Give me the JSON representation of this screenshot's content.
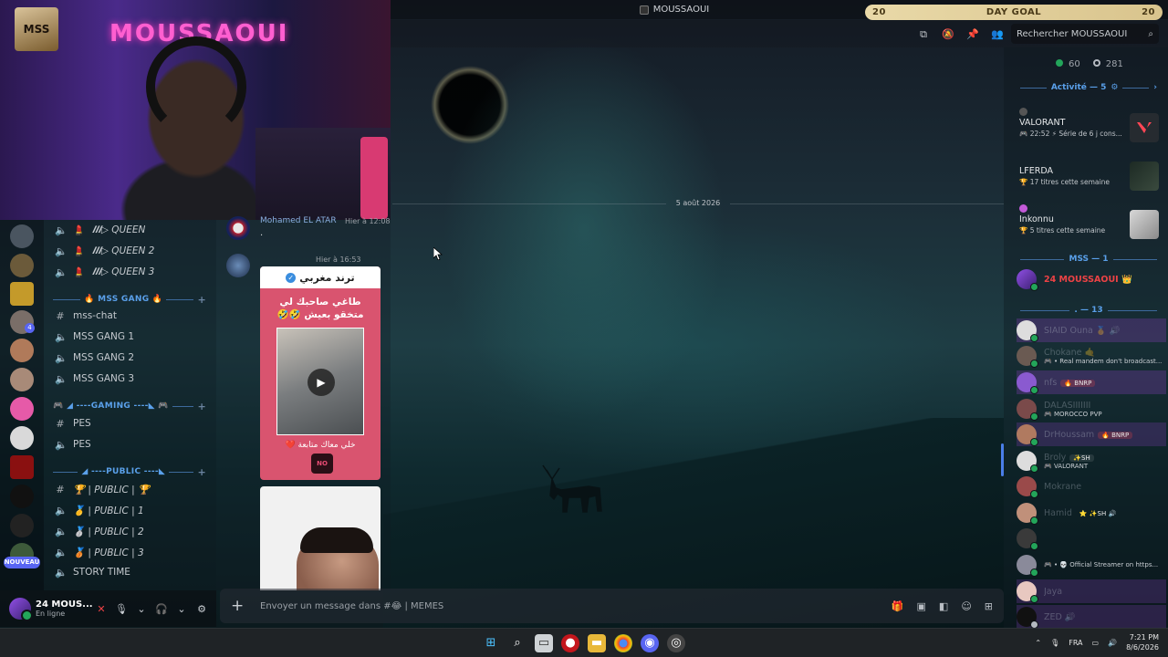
{
  "window": {
    "title": "MOUSSAOUI"
  },
  "day_goal": {
    "label": "DAY GOAL",
    "left_value": "20",
    "right_value": "20",
    "progress": 1.0
  },
  "search": {
    "placeholder": "Rechercher MOUSSAOUI"
  },
  "date_separator": "5 août 2026",
  "cam": {
    "neon_text": "MOUSSAOUI",
    "logo_text": "MSS"
  },
  "rail": {
    "badge": "4",
    "new_label": "NOUVEAU"
  },
  "channels": {
    "items_top": [
      {
        "icon": "speaker",
        "label": "𝑰𝑰𝑰▷ QUEEN",
        "emoji": "💄"
      },
      {
        "icon": "speaker",
        "label": "𝑰𝑰𝑰▷ QUEEN 2",
        "emoji": "💄"
      },
      {
        "icon": "speaker",
        "label": "𝑰𝑰𝑰▷ QUEEN 3",
        "emoji": "💄"
      }
    ],
    "cat_gang": "🔥 MSS GANG 🔥",
    "gang": [
      {
        "icon": "#",
        "label": "mss-chat"
      },
      {
        "icon": "speaker",
        "label": "MSS GANG 1"
      },
      {
        "icon": "speaker",
        "label": "MSS GANG 2"
      },
      {
        "icon": "speaker",
        "label": "MSS GANG 3"
      }
    ],
    "cat_gaming": "🎮 ◢ ----GAMING ----◣ 🎮",
    "gaming": [
      {
        "icon": "#",
        "label": "PES"
      },
      {
        "icon": "speaker",
        "label": "PES"
      }
    ],
    "cat_public": "◢ ----PUBLIC ----◣",
    "public": [
      {
        "icon": "#",
        "label": "🏆 | PUBLIC | 🏆"
      },
      {
        "icon": "speaker",
        "label": "🥇 | PUBLIC | 1"
      },
      {
        "icon": "speaker",
        "label": "🥈 | PUBLIC | 2"
      },
      {
        "icon": "speaker",
        "label": "🥉 | PUBLIC | 3"
      },
      {
        "icon": "speaker",
        "label": "STORY TIME"
      }
    ]
  },
  "chat": {
    "msg1_author": "Mohamed EL ATAR",
    "msg1_time": "Hier à 12:08",
    "msg1_text": ".",
    "msg2_author": "",
    "msg2_time": "Hier à 16:53",
    "card_header": "ترند مغربي",
    "card_caption": "طاغي صاحبك لي متخقو بعيش 🤣🤣",
    "card_footer": "خلي معاك متابعة ❤️",
    "card_logo": "NO FILL"
  },
  "user_panel": {
    "name": "24 MOUS...",
    "status": "En ligne"
  },
  "composer": {
    "placeholder": "Envoyer un message dans #😂 | MEMES"
  },
  "members": {
    "online": "60",
    "total": "281",
    "activity_header": "Activité — 5",
    "activities": [
      {
        "game": "VALORANT",
        "sub": "🎮 22:52 ⚡ Série de 6 j cons..."
      },
      {
        "game": "LFERDA",
        "sub": "🏆 17 titres cette semaine"
      },
      {
        "game": "Inkonnu",
        "sub": "🏆 5 titres cette semaine"
      }
    ],
    "mss_header": "MSS — 1",
    "owner": "24 MOUSSAOUI 👑",
    "group_header": ". — 13",
    "list": [
      {
        "name": "SIAID Ouna 🥇 🔊",
        "sub": ""
      },
      {
        "name": "Chokane 🤙",
        "sub": "🎮 • Real mandem don't broadcast..."
      },
      {
        "name": "nfs",
        "tag": "🔥 BNRP",
        "sub": ""
      },
      {
        "name": "DALASIIIIIII",
        "sub": "🎮 MOROCCO PVP"
      },
      {
        "name": "DrHoussam",
        "tag": "🔥 BNRP",
        "sub": ""
      },
      {
        "name": "Broly",
        "tag": "✨SH",
        "sub": "🎮 VALORANT"
      },
      {
        "name": "Mokrane",
        "sub": ""
      },
      {
        "name": "Hamid",
        "tag": "⭐ ✨SH 🔊",
        "sub": ""
      },
      {
        "name": "",
        "sub": ""
      },
      {
        "name": "",
        "sub": "🎮 • 💀 Official Streamer on https..."
      },
      {
        "name": "Jaya",
        "sub": ""
      },
      {
        "name": "ZED 🔊",
        "sub": ""
      }
    ]
  },
  "taskbar": {
    "lang": "FRA",
    "time": "7:21 PM",
    "date": "8/6/2026"
  },
  "colors": {
    "accent": "#5aa0ea",
    "online": "#23a55a",
    "danger": "#ed4245",
    "card": "#d9546f"
  }
}
